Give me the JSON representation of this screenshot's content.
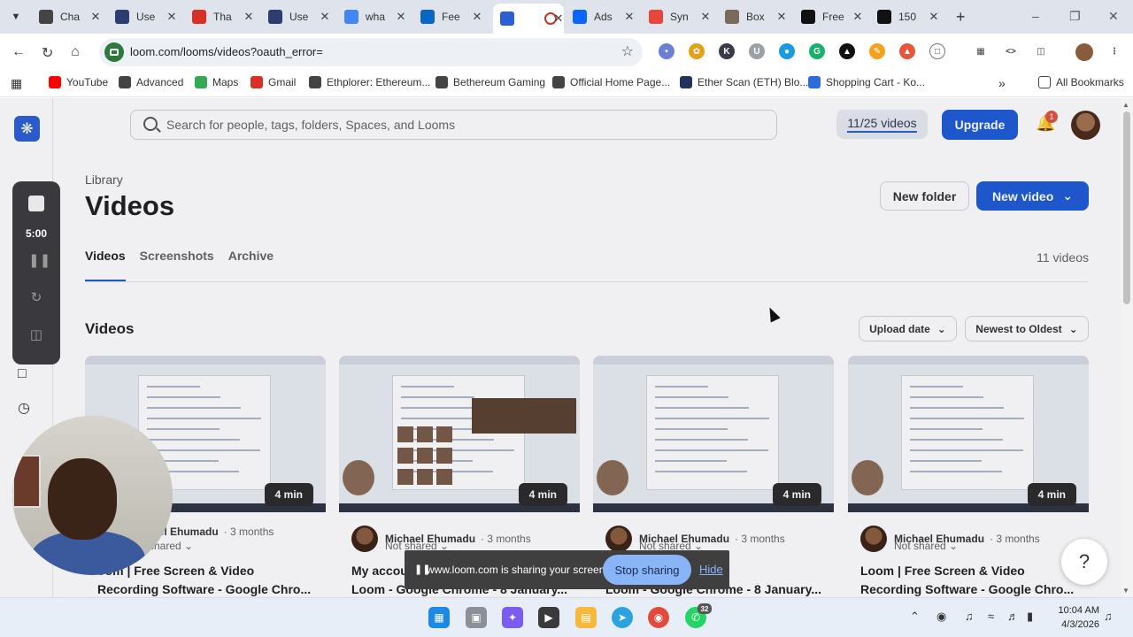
{
  "browser": {
    "tabs": [
      {
        "title": "Cha",
        "favicon": "chatgpt-icon",
        "color": "#444444"
      },
      {
        "title": "Use",
        "favicon": "user-icon",
        "color": "#2c3e70"
      },
      {
        "title": "Tha",
        "favicon": "gmail-icon",
        "color": "#d93025"
      },
      {
        "title": "Use",
        "favicon": "user-icon",
        "color": "#2c3e70"
      },
      {
        "title": "wha",
        "favicon": "google-icon",
        "color": "#4285f4"
      },
      {
        "title": "Fee",
        "favicon": "linkedin-icon",
        "color": "#0a66c2"
      },
      {
        "title": "",
        "favicon": "loom-icon",
        "color": "#2c5fd4"
      },
      {
        "title": "Ads",
        "favicon": "meta-icon",
        "color": "#0866ff"
      },
      {
        "title": "Syn",
        "favicon": "synthesia-icon",
        "color": "#e8453c"
      },
      {
        "title": "Box",
        "favicon": "box-icon",
        "color": "#7a6a5a"
      },
      {
        "title": "Free",
        "favicon": "vercel-icon",
        "color": "#111111"
      },
      {
        "title": "150",
        "favicon": "vercel-icon",
        "color": "#111111"
      }
    ],
    "url": "loom.com/looms/videos?oauth_error=",
    "bookmarks": [
      {
        "label": "YouTube",
        "icon": "youtube-icon",
        "color": "#ff0000"
      },
      {
        "label": "Advanced",
        "icon": "globe-icon",
        "color": "#444444"
      },
      {
        "label": "Maps",
        "icon": "maps-icon",
        "color": "#34a853"
      },
      {
        "label": "Gmail",
        "icon": "gmail-icon",
        "color": "#d93025"
      },
      {
        "label": "Ethplorer: Ethereum...",
        "icon": "ethereum-icon",
        "color": "#444444"
      },
      {
        "label": "Bethereum Gaming",
        "icon": "globe-icon",
        "color": "#444444"
      },
      {
        "label": "Official Home Page...",
        "icon": "globe-icon",
        "color": "#444444"
      },
      {
        "label": "Ether Scan (ETH) Blo...",
        "icon": "etherscan-icon",
        "color": "#21325b"
      },
      {
        "label": "Shopping Cart - Ko...",
        "icon": "flag-icon",
        "color": "#2d6cdf"
      }
    ],
    "all_bookmarks": "All Bookmarks"
  },
  "app": {
    "search_placeholder": "Search for people, tags, folders, Spaces, and Looms",
    "quota": "11/25 videos",
    "upgrade": "Upgrade",
    "notifications": "1",
    "breadcrumb": "Library",
    "title": "Videos",
    "new_folder": "New folder",
    "new_video": "New video",
    "tabs": [
      "Videos",
      "Screenshots",
      "Archive"
    ],
    "video_count": "11 videos",
    "section": "Videos",
    "sort_field": "Upload date",
    "sort_order": "Newest to Oldest",
    "colors": {
      "primary": "#1d5bd6",
      "badge": "#e0533d"
    }
  },
  "videos": [
    {
      "duration": "4 min",
      "author": "Michael Ehumadu",
      "author_visible": "chael Ehumadu",
      "age": "3 months",
      "sharing": "Not shared",
      "sharing_visible": "shared",
      "title": "Loom | Free Screen & Video Recording Software - Google Chro...",
      "title_visible": "oom | Free Screen & Video Recording Software - Google Chro..."
    },
    {
      "duration": "4 min",
      "author": "Michael Ehumadu",
      "age": "3 months",
      "sharing": "Not shared",
      "title": "My accou",
      "title_visible": "My accou",
      "title_line2": "Loom - Google Chrome - 8 January..."
    },
    {
      "duration": "4 min",
      "author": "Michael Ehumadu",
      "age": "3 months",
      "sharing": "Not shared",
      "title": "l Settings |",
      "title_visible": "l Settings |",
      "title_line2": "Loom - Google Chrome - 8 January..."
    },
    {
      "duration": "4 min",
      "author": "Michael Ehumadu",
      "age": "3 months",
      "sharing": "Not shared",
      "title": "Loom | Free Screen & Video Recording Software - Google Chro...",
      "title_visible": "Loom | Free Screen & Video Recording Software - Google Chro..."
    }
  ],
  "recorder": {
    "timer": "5:00"
  },
  "share_notice": {
    "message": "www.loom.com is sharing your screen.",
    "stop": "Stop sharing",
    "hide": "Hide"
  },
  "help": "?",
  "taskbar": {
    "time": "10:04 AM",
    "date": "4/3/2026",
    "whatsapp_badge": "32"
  }
}
